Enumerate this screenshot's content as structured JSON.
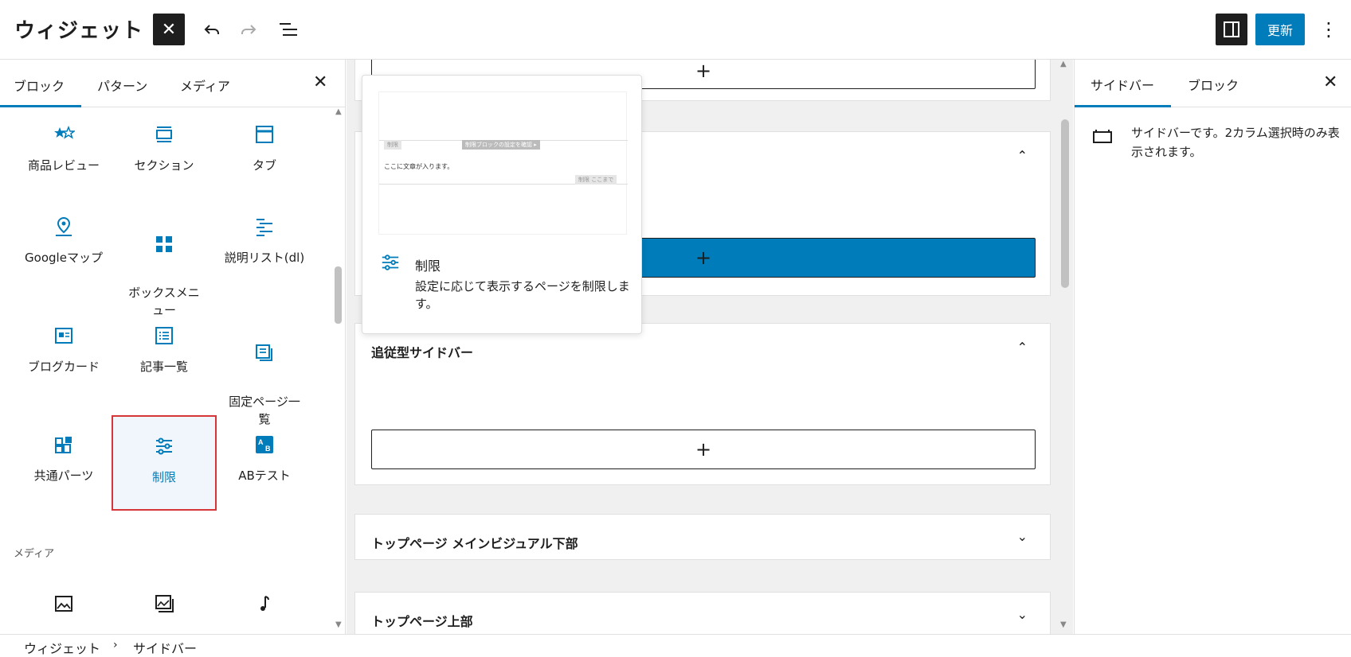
{
  "header": {
    "title": "ウィジェット",
    "update_label": "更新",
    "more_glyph": "⋮"
  },
  "inserter": {
    "tabs": [
      "ブロック",
      "パターン",
      "メディア"
    ],
    "blocks": [
      {
        "label": "商品レビュー",
        "icon": "star-rating-icon"
      },
      {
        "label": "セクション",
        "icon": "section-icon"
      },
      {
        "label": "タブ",
        "icon": "tab-icon"
      },
      {
        "label": "Googleマップ",
        "icon": "map-pin-icon"
      },
      {
        "label": "ボックスメニ\nュー",
        "icon": "grid-icon"
      },
      {
        "label": "説明リスト(dl)",
        "icon": "description-list-icon"
      },
      {
        "label": "ブログカード",
        "icon": "blog-card-icon"
      },
      {
        "label": "記事一覧",
        "icon": "post-list-icon"
      },
      {
        "label": "固定ページ一\n覧",
        "icon": "page-list-icon"
      },
      {
        "label": "共通パーツ",
        "icon": "shared-parts-icon"
      },
      {
        "label": "制限",
        "icon": "restriction-sliders-icon"
      },
      {
        "label": "ABテスト",
        "icon": "ab-test-icon"
      }
    ],
    "media_section_label": "メディア",
    "media_blocks": [
      {
        "icon": "image-icon"
      },
      {
        "icon": "gallery-icon"
      },
      {
        "icon": "music-note-icon"
      }
    ]
  },
  "canvas": {
    "areas": [
      {
        "title": "",
        "expanded": true
      },
      {
        "title": "",
        "expanded": true
      },
      {
        "title": "追従型サイドバー",
        "expanded": true
      },
      {
        "title": "トップページ メインビジュアル下部",
        "expanded": false
      },
      {
        "title": "トップページ上部",
        "expanded": false
      }
    ],
    "add_glyph": "+"
  },
  "popover": {
    "title": "制限",
    "description": "設定に応じて表示するページを制限します。",
    "preview": {
      "tag_left": "制限",
      "tag_center": "制限ブロックの設定を確認 ▸",
      "body_text": "ここに文章が入ります。",
      "tag_end": "制限 ここまで"
    }
  },
  "settings": {
    "tabs": [
      "サイドバー",
      "ブロック"
    ],
    "description": "サイドバーです。2カラム選択時のみ表示されます。"
  },
  "breadcrumb": [
    "ウィジェット",
    "サイドバー"
  ],
  "colors": {
    "accent": "#007cba",
    "selection_border": "#d63638"
  }
}
